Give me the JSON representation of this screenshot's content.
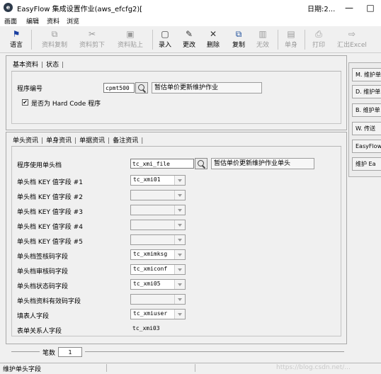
{
  "window": {
    "title": "EasyFlow 集成设置作业(aws_efcfg2)[",
    "date_label": "日期:2...",
    "minimize": "—",
    "maximize": "□"
  },
  "menu": [
    "画面",
    "编辑",
    "资料",
    "浏览"
  ],
  "toolbar": [
    {
      "label": "语言",
      "icon": "flag-icon",
      "glyph": "⚑",
      "enabled": true
    },
    {
      "label": "资料复制",
      "icon": "copy-data-icon",
      "glyph": "⧉",
      "enabled": false
    },
    {
      "label": "资料剪下",
      "icon": "scissors-icon",
      "glyph": "✂",
      "enabled": false
    },
    {
      "label": "资料贴上",
      "icon": "paste-icon",
      "glyph": "▣",
      "enabled": false
    },
    {
      "label": "录入",
      "icon": "new-document-icon",
      "glyph": "▢",
      "enabled": true
    },
    {
      "label": "更改",
      "icon": "pencil-icon",
      "glyph": "✎",
      "enabled": true
    },
    {
      "label": "删除",
      "icon": "delete-x-icon",
      "glyph": "✕",
      "enabled": true
    },
    {
      "label": "复制",
      "icon": "duplicate-icon",
      "glyph": "⧉",
      "enabled": true
    },
    {
      "label": "无效",
      "icon": "trash-icon",
      "glyph": "▥",
      "enabled": false
    },
    {
      "label": "单身",
      "icon": "detail-icon",
      "glyph": "▤",
      "enabled": false
    },
    {
      "label": "打印",
      "icon": "printer-icon",
      "glyph": "⎙",
      "enabled": false
    },
    {
      "label": "汇出Excel",
      "icon": "export-excel-icon",
      "glyph": "⇨",
      "enabled": false
    }
  ],
  "top_panel": {
    "tabs": [
      "基本资料",
      "状态"
    ],
    "program_label": "程序编号",
    "program_value": "cpmt500",
    "program_desc": "暂估单价更新维护作业",
    "hardcode_label": "是否为 Hard Code 程序",
    "hardcode_checked": true,
    "check_mark": "✔"
  },
  "side_buttons": [
    "M. 维护单",
    "D. 维护单",
    "B. 维护单",
    "W. 传送",
    "EasyFlow",
    "维护 Ea"
  ],
  "bottom_panel": {
    "tabs": [
      "单头资讯",
      "单身资讯",
      "单据资讯",
      "备注资讯"
    ],
    "header_table_label": "程序使用单头档",
    "header_table_value": "tc_xmi_file",
    "header_table_desc": "暂估单价更新维护作业单头",
    "fields": [
      {
        "label": "单头档 KEY 值字段 #1",
        "value": "tc_xmi01",
        "type": "combo"
      },
      {
        "label": "单头档 KEY 值字段 #2",
        "value": "",
        "type": "combo"
      },
      {
        "label": "单头档 KEY 值字段 #3",
        "value": "",
        "type": "combo"
      },
      {
        "label": "单头档 KEY 值字段 #4",
        "value": "",
        "type": "combo"
      },
      {
        "label": "单头档 KEY 值字段 #5",
        "value": "",
        "type": "combo"
      },
      {
        "label": "单头档签核码字段",
        "value": "tc_xmimksg",
        "type": "combo"
      },
      {
        "label": "单头档审核码字段",
        "value": "tc_xmiconf",
        "type": "combo"
      },
      {
        "label": "单头档状态码字段",
        "value": "tc_xmi05",
        "type": "combo"
      },
      {
        "label": "单头档资料有效码字段",
        "value": "",
        "type": "combo"
      },
      {
        "label": "填表人字段",
        "value": "tc_xmiuser",
        "type": "combo"
      },
      {
        "label": "表单关系人字段",
        "value": "tc_xmi03",
        "type": "text"
      }
    ]
  },
  "footer": {
    "count_label": "笔数",
    "count_value": "1",
    "status_text": "维护单头字段",
    "watermark": "https://blog.csdn.net/..."
  }
}
